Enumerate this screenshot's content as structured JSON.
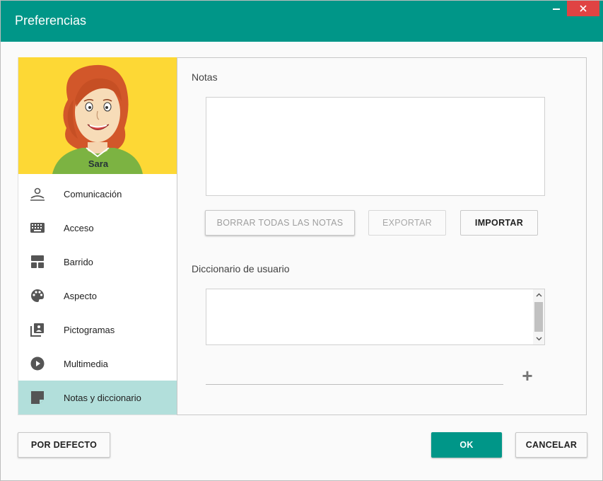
{
  "window": {
    "title": "Preferencias",
    "accent_color": "#009688",
    "close_color": "#e04343"
  },
  "profile": {
    "name": "Sara",
    "background_color": "#fdd835"
  },
  "sidebar": {
    "items": [
      {
        "label": "Comunicación",
        "icon": "person-speaking-icon"
      },
      {
        "label": "Acceso",
        "icon": "keyboard-icon"
      },
      {
        "label": "Barrido",
        "icon": "scan-blocks-icon"
      },
      {
        "label": "Aspecto",
        "icon": "palette-icon"
      },
      {
        "label": "Pictogramas",
        "icon": "pictogram-library-icon"
      },
      {
        "label": "Multimedia",
        "icon": "play-circle-icon"
      },
      {
        "label": "Notas y diccionario",
        "icon": "note-icon",
        "active": true
      }
    ]
  },
  "notes": {
    "title": "Notas",
    "value": "",
    "buttons": {
      "clear_all": "BORRAR TODAS LAS NOTAS",
      "export": "EXPORTAR",
      "import": "IMPORTAR"
    }
  },
  "dictionary": {
    "title": "Diccionario de usuario",
    "words": [],
    "new_word": "",
    "add_label": "+"
  },
  "footer": {
    "default_label": "POR DEFECTO",
    "ok_label": "OK",
    "cancel_label": "CANCELAR"
  }
}
